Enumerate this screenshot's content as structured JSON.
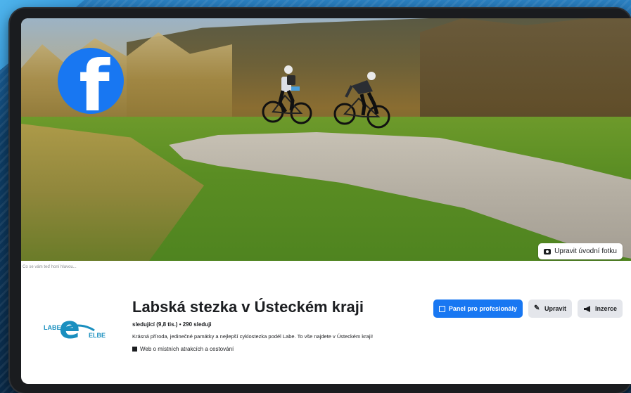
{
  "colors": {
    "facebook_blue": "#1877f2",
    "brand_teal": "#1a8fbf",
    "text_dark": "#1c1e21",
    "button_gray": "#e4e6eb"
  },
  "icons": {
    "facebook_logo": "facebook-logo-icon",
    "camera": "camera-icon",
    "dashboard": "dashboard-icon",
    "pencil": "pencil-icon",
    "megaphone": "megaphone-icon",
    "flag": "flag-icon"
  },
  "cover": {
    "edit_button_label": "Upravit úvodní fotku",
    "caption_stub": "Co se vám teď honí hlavou..."
  },
  "profile": {
    "logo_left": "LABE",
    "logo_right": "ELBE",
    "title": "Labská stezka v Ústeckém kraji",
    "followers": "sledující (9,8 tis.) • 290 sleduji",
    "description": "Krásná příroda, jedinečné památky a nejlepší cyklostezka podél Labe. To vše najdete v Ústeckém kraji!",
    "category": "Web o místních atrakcích a cestování"
  },
  "actions": {
    "professional_panel": "Panel pro profesionály",
    "edit": "Upravit",
    "ads": "Inzerce"
  }
}
